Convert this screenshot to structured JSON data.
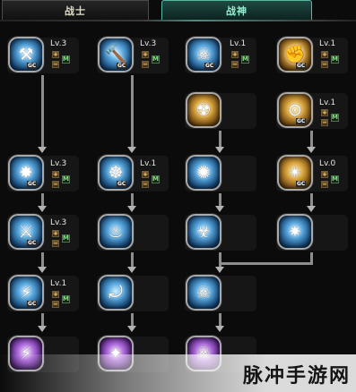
{
  "tabs": {
    "warrior": "战士",
    "god": "战神"
  },
  "skills": [
    {
      "level": "Lv.3",
      "badge": "GC",
      "plus": "+",
      "minus": "−",
      "m": "M",
      "glyph": "⚒",
      "style": "blue"
    },
    {
      "level": "Lv.3",
      "badge": "GC",
      "plus": "+",
      "minus": "−",
      "m": "M",
      "glyph": "🔨",
      "style": "blue"
    },
    {
      "level": "Lv.1",
      "badge": "GC",
      "plus": "+",
      "minus": "−",
      "m": "M",
      "glyph": "☠",
      "style": "blue"
    },
    {
      "level": "Lv.1",
      "badge": "GC",
      "plus": "+",
      "minus": "−",
      "m": "M",
      "glyph": "✊",
      "style": "gold"
    },
    {
      "glyph": "☢",
      "style": "gold"
    },
    {
      "level": "Lv.1",
      "badge": "GC",
      "plus": "+",
      "minus": "−",
      "m": "M",
      "glyph": "⊙",
      "style": "gold"
    },
    {
      "level": "Lv.3",
      "badge": "GC",
      "plus": "+",
      "minus": "−",
      "m": "M",
      "glyph": "✸",
      "style": "blue"
    },
    {
      "level": "Lv.1",
      "badge": "GC",
      "plus": "+",
      "minus": "−",
      "m": "M",
      "glyph": "☸",
      "style": "blue"
    },
    {
      "glyph": "✺",
      "style": "blue"
    },
    {
      "level": "Lv.0",
      "badge": "GC",
      "plus": "+",
      "minus": "−",
      "m": "M",
      "glyph": "✴",
      "style": "gold"
    },
    {
      "level": "Lv.3",
      "badge": "GC",
      "plus": "+",
      "minus": "−",
      "m": "M",
      "glyph": "⚔",
      "style": "blue"
    },
    {
      "glyph": "♨",
      "style": "blue"
    },
    {
      "glyph": "☣",
      "style": "blue"
    },
    {
      "glyph": "✷",
      "style": "blue"
    },
    {
      "level": "Lv.1",
      "badge": "GC",
      "plus": "+",
      "minus": "−",
      "m": "M",
      "glyph": "⚡",
      "style": "blue"
    },
    {
      "glyph": "⤾",
      "style": "blue"
    },
    {
      "glyph": "☠",
      "style": "blue"
    },
    {
      "glyph": "⚡",
      "style": "purple"
    },
    {
      "glyph": "✦",
      "style": "purple"
    },
    {
      "glyph": "☠",
      "style": "purple"
    }
  ],
  "watermark": "脉冲手游网"
}
